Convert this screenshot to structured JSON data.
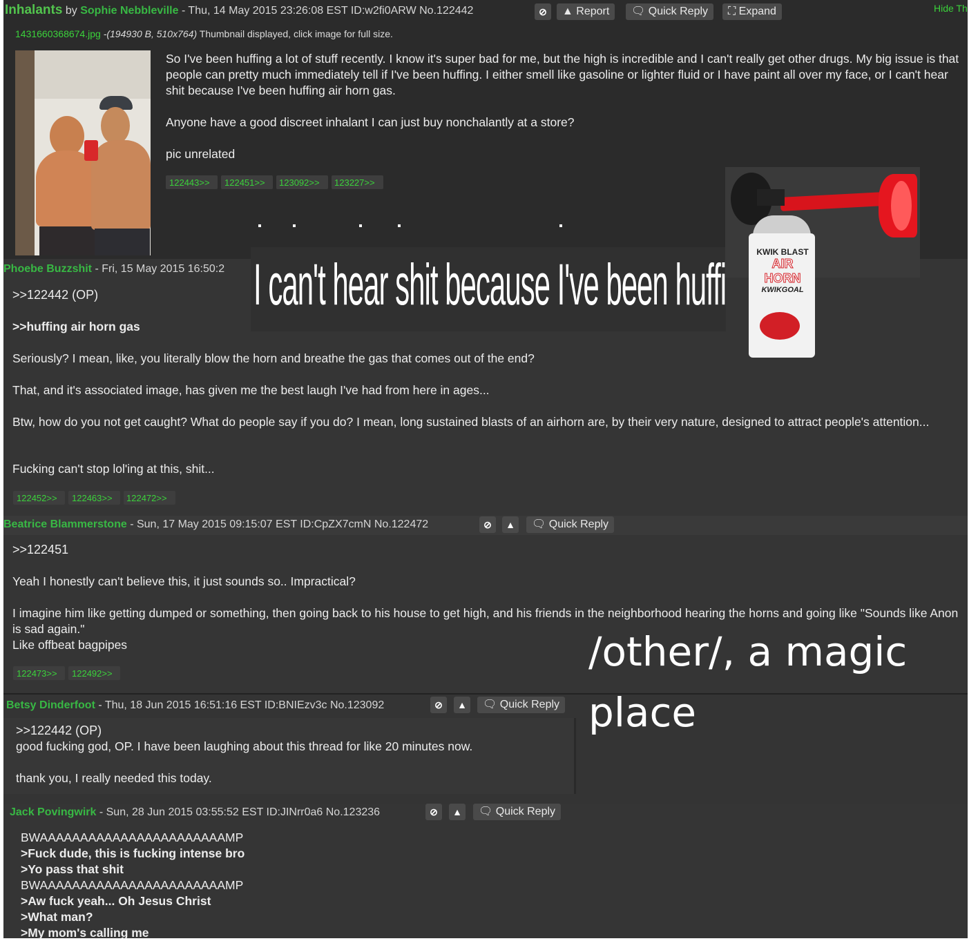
{
  "op": {
    "subject": "Inhalants",
    "by": "by",
    "name": "Sophie Nebbleville",
    "meta": "- Thu, 14 May 2015 23:26:08 EST ID:w2fi0ARW No.122442",
    "report_label": "Report",
    "quick_reply_label": "Quick Reply",
    "expand_label": "Expand",
    "hide_label": "Hide Th",
    "file_name": "1431660368674.jpg",
    "file_info": "-(194930 B, 510x764)",
    "file_hint": "Thumbnail displayed, click image for full size.",
    "body": [
      "So I've been huffing a lot of stuff recently. I know it's super bad for me, but the high is incredible and I can't really get other drugs. My big issue is that people can pretty much immediately tell if I've been huffing. I either smell like gasoline or lighter fluid or I have paint all over my face, or I can't hear shit because I've been huffing air horn gas.",
      "Anyone have a good discreet inhalant I can just buy nonchalantly at a store?",
      "pic unrelated"
    ],
    "backlinks": [
      "122443>>",
      "122451>>",
      "123092>>",
      "123227>>"
    ]
  },
  "overlay": {
    "caption": "I can't hear shit because I've been huffing air horn gas.",
    "can_label_1": "KWIK BLAST",
    "can_label_2": "AIR",
    "can_label_3": "HORN",
    "can_label_4": "KWIKGOAL",
    "other_caption_1": "/other/, a magic",
    "other_caption_2": "place"
  },
  "posts": [
    {
      "name": "Phoebe Buzzshit",
      "meta": "- Fri, 15 May 2015 16:50:2",
      "quote": ">>122442 (OP)",
      "greentext": ">>huffing air horn gas",
      "p1": "Seriously? I mean, like, you literally blow the horn and breathe the gas that comes out of the end?",
      "p2": "That, and it's associated image, has given me the best laugh I've had from here in ages...",
      "p3": "Btw, how do you not get caught? What do people say if you do? I mean, long sustained blasts of an airhorn are, by their very nature, designed to attract people's attention...",
      "p4": "Fucking can't stop lol'ing at this, shit...",
      "backlinks": [
        "122452>>",
        "122463>>",
        "122472>>"
      ]
    },
    {
      "name": "Beatrice Blammerstone",
      "meta": "- Sun, 17 May 2015 09:15:07 EST ID:CpZX7cmN No.122472",
      "quick_reply_label": "Quick Reply",
      "quote": ">>122451",
      "p1": "Yeah I honestly can't believe this, it just sounds so.. Impractical?",
      "p2": "I imagine him like getting dumped or something, then going back to his house to get high, and his friends in the neighborhood hearing the horns and going like \"Sounds like Anon is sad again.\"",
      "p3": "Like offbeat bagpipes",
      "backlinks": [
        "122473>>",
        "122492>>"
      ]
    },
    {
      "name": "Betsy Dinderfoot",
      "meta": "- Thu, 18 Jun 2015 16:51:16 EST ID:BNIEzv3c No.123092",
      "quick_reply_label": "Quick Reply",
      "quote": ">>122442 (OP)",
      "p1": "good fucking god, OP. I have been laughing about this thread for like 20 minutes now.",
      "p2": "thank you, I really needed this today."
    },
    {
      "name": "Jack Povingwirk",
      "meta": "- Sun, 28 Jun 2015 03:55:52 EST ID:JINrr0a6 No.123236",
      "quick_reply_label": "Quick Reply",
      "lines": [
        {
          "text": "BWAAAAAAAAAAAAAAAAAAAAAAAMP",
          "green": false
        },
        {
          "text": ">Fuck dude, this is fucking intense bro",
          "green": true
        },
        {
          "text": ">Yo pass that shit",
          "green": true
        },
        {
          "text": "BWAAAAAAAAAAAAAAAAAAAAAAAMP",
          "green": false
        },
        {
          "text": ">Aw fuck yeah... Oh Jesus Christ",
          "green": true
        },
        {
          "text": ">What man?",
          "green": true
        },
        {
          "text": ">My mom's calling me",
          "green": true
        }
      ]
    }
  ]
}
